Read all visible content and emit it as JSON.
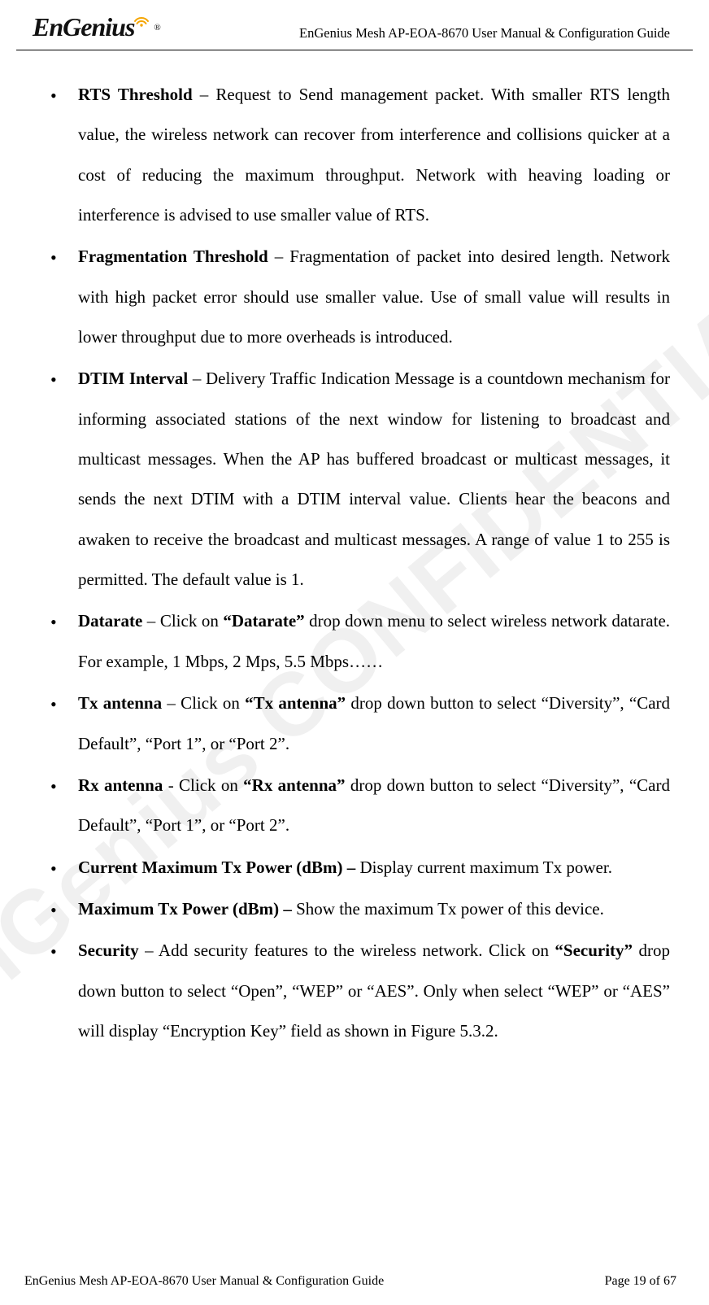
{
  "watermark": "EnGenius CONFIDENTIAL",
  "header": {
    "logo_text": "EnGenius",
    "doc_title": "EnGenius Mesh AP-EOA-8670 User Manual & Configuration Guide"
  },
  "bullets": [
    {
      "lead": "RTS Threshold",
      "sep": " – ",
      "rest": "Request to Send management packet. With smaller RTS length value, the wireless network can recover from interference and collisions quicker at a cost of reducing the maximum throughput. Network with heaving loading or interference is advised to use smaller value of RTS."
    },
    {
      "lead": "Fragmentation Threshold",
      "sep": " – ",
      "rest": "Fragmentation of packet into desired length. Network with high packet error should use smaller value. Use of small value will results in lower throughput due to more overheads is introduced."
    },
    {
      "lead": "DTIM Interval",
      "sep": " – ",
      "rest": "Delivery Traffic Indication Message is a countdown mechanism for informing associated stations of the next window for listening to broadcast and multicast messages. When the AP has buffered broadcast or multicast messages, it sends the next DTIM with a DTIM interval value. Clients hear the beacons and awaken to receive the broadcast and multicast messages. A range of value 1 to 255 is permitted. The default value is 1."
    },
    {
      "lead": "Datarate",
      "sep": " – ",
      "pre": "Click on ",
      "quoted": "“Datarate”",
      "post": " drop down menu to select wireless network datarate. For example, 1 Mbps, 2 Mps, 5.5 Mbps……"
    },
    {
      "lead": "Tx antenna",
      "sep": " – ",
      "pre": "Click on ",
      "quoted": "“Tx antenna”",
      "post": " drop down button to select “Diversity”, “Card Default”, “Port 1”, or “Port 2”."
    },
    {
      "lead": "Rx antenna",
      "sep": " - ",
      "pre": "Click on ",
      "quoted": "“Rx antenna”",
      "post": " drop down button to select “Diversity”, “Card Default”, “Port 1”, or “Port 2”."
    },
    {
      "lead": "Current Maximum Tx Power (dBm) –",
      "sep": " ",
      "rest": "Display current maximum Tx power."
    },
    {
      "lead": "Maximum Tx Power (dBm) –",
      "sep": " ",
      "rest": "Show the maximum Tx power of this device."
    },
    {
      "lead": "Security",
      "sep": " – ",
      "pre": "Add security features to the wireless network. Click on ",
      "quoted": "“Security”",
      "post": " drop down button to select “Open”, “WEP” or “AES”. Only when select “WEP” or “AES” will display “Encryption Key” field as shown in Figure 5.3.2."
    }
  ],
  "footer": {
    "left": "EnGenius Mesh AP-EOA-8670 User Manual & Configuration Guide",
    "right": "Page 19 of 67"
  }
}
